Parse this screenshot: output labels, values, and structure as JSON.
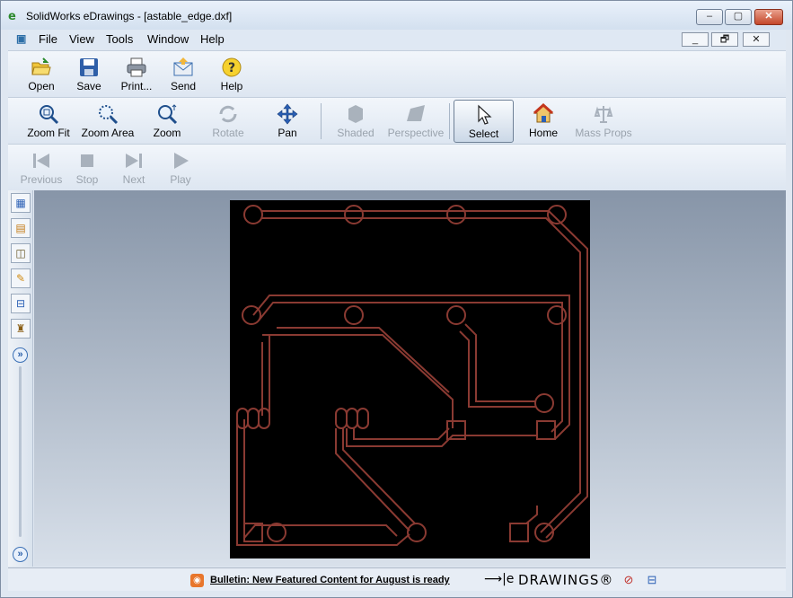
{
  "window": {
    "title": "SolidWorks eDrawings - [astable_edge.dxf]"
  },
  "caption_buttons": {
    "minimize": "–",
    "maximize": "▢",
    "close": "✕"
  },
  "menu": {
    "items": [
      "File",
      "View",
      "Tools",
      "Window",
      "Help"
    ]
  },
  "mdi_buttons": {
    "minimize": "_",
    "restore": "🗗",
    "close": "✕"
  },
  "toolbar_file": [
    {
      "label": "Open",
      "icon": "open-folder-icon"
    },
    {
      "label": "Save",
      "icon": "save-icon"
    },
    {
      "label": "Print...",
      "icon": "print-icon"
    },
    {
      "label": "Send",
      "icon": "send-icon"
    },
    {
      "label": "Help",
      "icon": "help-icon"
    }
  ],
  "toolbar_view": [
    {
      "label": "Zoom Fit",
      "icon": "zoom-fit-icon",
      "enabled": true
    },
    {
      "label": "Zoom Area",
      "icon": "zoom-area-icon",
      "enabled": true
    },
    {
      "label": "Zoom",
      "icon": "zoom-icon",
      "enabled": true
    },
    {
      "label": "Rotate",
      "icon": "rotate-icon",
      "enabled": false
    },
    {
      "label": "Pan",
      "icon": "pan-icon",
      "enabled": true
    },
    {
      "label": "Shaded",
      "icon": "shaded-icon",
      "enabled": false
    },
    {
      "label": "Perspective",
      "icon": "perspective-icon",
      "enabled": false
    },
    {
      "label": "Select",
      "icon": "select-cursor-icon",
      "enabled": true,
      "active": true
    },
    {
      "label": "Home",
      "icon": "home-icon",
      "enabled": true
    },
    {
      "label": "Mass Props",
      "icon": "mass-props-icon",
      "enabled": false
    }
  ],
  "toolbar_playback": [
    {
      "label": "Previous",
      "icon": "previous-icon"
    },
    {
      "label": "Stop",
      "icon": "stop-icon"
    },
    {
      "label": "Next",
      "icon": "next-icon"
    },
    {
      "label": "Play",
      "icon": "play-icon"
    }
  ],
  "side_tools": [
    "sheets-icon",
    "layers-icon",
    "components-icon",
    "markup-pen-icon",
    "measure-icon",
    "stamp-icon"
  ],
  "side_expand": "»",
  "status": {
    "bulletin": "Bulletin: New Featured Content for August is ready",
    "brand_arrow": "⟶|e",
    "brand": "DRAWINGS®"
  },
  "colors": {
    "trace": "#8a3a32",
    "canvas_bg": "#000000"
  }
}
